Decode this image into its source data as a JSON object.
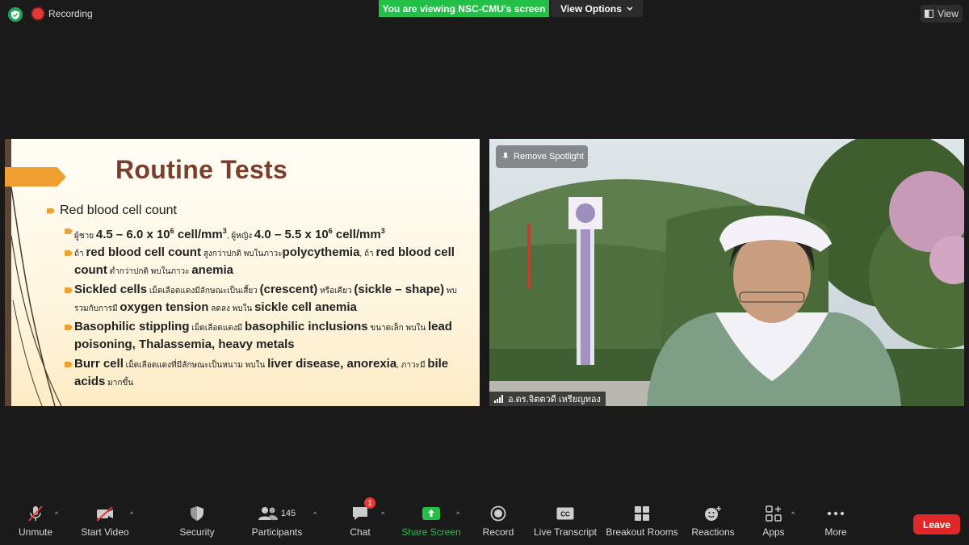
{
  "top": {
    "recording_label": "Recording",
    "viewing_banner": "You are viewing NSC-CMU's screen",
    "view_options": "View Options",
    "view_button": "View"
  },
  "slide": {
    "title": "Routine Tests",
    "heading_bullet": "Red blood cell count",
    "items": [
      {
        "parts": [
          "ผู้ชาย ",
          "4.5 – 6.0 x 10",
          "6",
          " cell/mm",
          "3",
          ", ผู้หญิง ",
          "4.0 – 5.5 x 10",
          "6",
          " cell/mm",
          "3"
        ]
      },
      {
        "parts": [
          "ถ้า ",
          "red blood cell count",
          " สูงกว่าปกติ พบในภาวะ",
          "polycythemia",
          ", ถ้า ",
          "red blood cell count",
          " ต่ำกว่าปกติ พบในภาวะ ",
          "anemia"
        ]
      },
      {
        "parts": [
          "Sickled cells",
          " เม็ดเลือดแดงมีลักษณะเป็นเสี้ยว ",
          "(crescent)",
          " หรือเคียว ",
          "(sickle – shape)",
          " พบรวมกับการมี ",
          "oxygen tension",
          " ลดลง พบใน ",
          "sickle cell anemia"
        ]
      },
      {
        "parts": [
          "Basophilic stippling",
          " เม็ดเลือดแดงมี ",
          "basophilic inclusions",
          " ขนาดเล็ก  พบใน ",
          "lead poisoning, Thalassemia, heavy metals"
        ]
      },
      {
        "parts": [
          "Burr cell",
          " เม็ดเลือดแดงที่มีลักษณะเป็นหนาม พบใน ",
          "liver disease, anorexia",
          ", ภาวะมี ",
          "bile acids",
          " มากขึ้น"
        ]
      }
    ]
  },
  "video": {
    "remove_spotlight": "Remove Spotlight",
    "participant_name": "อ.ดร.จิตตวดี เหรียญทอง"
  },
  "toolbar": {
    "unmute": "Unmute",
    "start_video": "Start Video",
    "security": "Security",
    "participants": "Participants",
    "participants_count": "145",
    "chat": "Chat",
    "chat_badge": "1",
    "share_screen": "Share Screen",
    "record": "Record",
    "live_transcript": "Live Transcript",
    "breakout_rooms": "Breakout Rooms",
    "reactions": "Reactions",
    "apps": "Apps",
    "more": "More",
    "leave": "Leave"
  },
  "colors": {
    "share_green": "#23c048",
    "leave_red": "#e02828",
    "slide_title": "#7a3e2c",
    "bullet_orange": "#f0a030"
  }
}
